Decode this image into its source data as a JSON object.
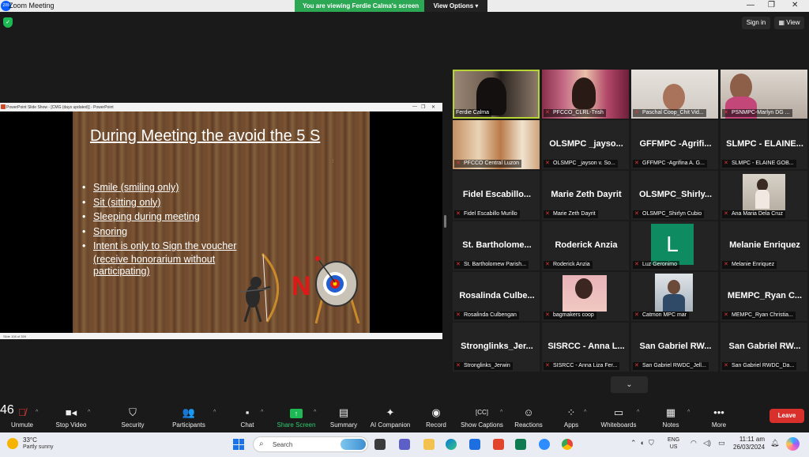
{
  "window": {
    "title": "Zoom Meeting",
    "banner_text": "You are viewing Ferdie Calma's screen",
    "view_options": "View Options",
    "sign_in": "Sign in",
    "view": "View"
  },
  "ppt": {
    "titlebar": "PowerPoint Slide Show - [CMG (days updated)] - PowerPoint",
    "status": "Slide 108 of 359"
  },
  "slide": {
    "title": "During Meeting the avoid the 5 S",
    "bullets": [
      "Smile (smiling only)",
      "Sit (sitting only)",
      "Sleeping during meeting",
      "Snoring",
      "Intent is only to Sign the voucher"
    ],
    "cont1": "(receive honorarium without",
    "cont2": "participating)",
    "no_letter": "N"
  },
  "gallery": {
    "tiles": [
      {
        "name": "",
        "label": "Ferdie Calma",
        "muted": false
      },
      {
        "name": "",
        "label": "PFCCO_CLRL-Trish",
        "muted": true
      },
      {
        "name": "",
        "label": "Paschal Coop_Chit Vid...",
        "muted": true
      },
      {
        "name": "",
        "label": "PSNMPC-Marlyn DG ...",
        "muted": true
      },
      {
        "name": "",
        "label": "PFCCO Central Luzon",
        "muted": true
      },
      {
        "name": "OLSMPC _jayso...",
        "label": "OLSMPC _jayson v. So...",
        "muted": true
      },
      {
        "name": "GFFMPC -Agrifi...",
        "label": "GFFMPC -Agrifina A. G...",
        "muted": true
      },
      {
        "name": "SLMPC - ELAINE...",
        "label": "SLMPC - ELAINE GOB...",
        "muted": true
      },
      {
        "name": "Fidel Escabillo...",
        "label": "Fidel Escabillo Murillo",
        "muted": true
      },
      {
        "name": "Marie Zeth Dayrit",
        "label": "Marie Zeth Dayrit",
        "muted": true
      },
      {
        "name": "OLSMPC_Shirly...",
        "label": "OLSMPC_Shirlyn Cubio",
        "muted": true
      },
      {
        "name": "",
        "label": "Ana Maria Dela Cruz",
        "muted": true
      },
      {
        "name": "St. Bartholome...",
        "label": "St. Bartholomew Parish...",
        "muted": true
      },
      {
        "name": "Roderick Anzia",
        "label": "Roderick Anzia",
        "muted": true
      },
      {
        "name": "",
        "avatar": "L",
        "label": "Luz Geronimo",
        "muted": true
      },
      {
        "name": "Melanie Enriquez",
        "label": "Melanie Enriquez",
        "muted": true
      },
      {
        "name": "Rosalinda Culbe...",
        "label": "Rosalinda Culbengan",
        "muted": true
      },
      {
        "name": "",
        "label": "bagmakers coop",
        "muted": true
      },
      {
        "name": "",
        "label": "Catmon MPC mar",
        "muted": true
      },
      {
        "name": "MEMPC_Ryan C...",
        "label": "MEMPC_Ryan Christia...",
        "muted": true
      },
      {
        "name": "Stronglinks_Jer...",
        "label": "Stronglinks_Jerwin",
        "muted": true
      },
      {
        "name": "SISRCC - Anna L...",
        "label": "SISRCC - Anna Liza Fer...",
        "muted": true
      },
      {
        "name": "San Gabriel RW...",
        "label": "San Gabriel RWDC_Jell...",
        "muted": true
      },
      {
        "name": "San Gabriel RW...",
        "label": "San Gabriel RWDC_Da...",
        "muted": true
      }
    ]
  },
  "toolbar": {
    "unmute": "Unmute",
    "stop_video": "Stop Video",
    "security": "Security",
    "participants": "Participants",
    "participants_count": "46",
    "chat": "Chat",
    "share_screen": "Share Screen",
    "summary": "Summary",
    "ai_companion": "AI Companion",
    "record": "Record",
    "show_captions": "Show Captions",
    "reactions": "Reactions",
    "apps": "Apps",
    "whiteboards": "Whiteboards",
    "notes": "Notes",
    "more": "More",
    "leave": "Leave"
  },
  "taskbar": {
    "temp": "33°C",
    "condition": "Partly sunny",
    "search": "Search",
    "lang1": "ENG",
    "lang2": "US",
    "time": "11:11 am",
    "date": "26/03/2024"
  }
}
